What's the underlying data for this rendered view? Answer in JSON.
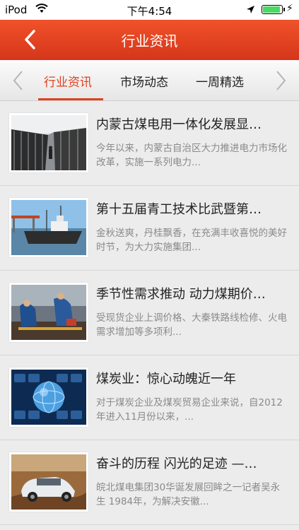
{
  "status_bar": {
    "carrier": "iPod",
    "time": "下午4:54",
    "battery_level": 0.9,
    "wifi_icon": "wifi-icon",
    "location_icon": "location-arrow-icon",
    "charging_icon": "bolt-icon"
  },
  "nav": {
    "title": "行业资讯",
    "back_icon": "chevron-left-icon",
    "color": "#e4431f"
  },
  "tabs": {
    "items": [
      {
        "label": "行业资讯",
        "active": true
      },
      {
        "label": "市场动态",
        "active": false
      },
      {
        "label": "一周精选",
        "active": false
      }
    ],
    "prev_icon": "chevron-left-icon",
    "next_icon": "chevron-right-icon",
    "active_color": "#e0401e"
  },
  "articles": [
    {
      "title": "内蒙古煤电用一体化发展显…",
      "summary": "今年以来，内蒙古自治区大力推进电力市场化改革，实施一系列电力..."
    },
    {
      "title": "第十五届青工技术比武暨第…",
      "summary": "金秋送爽，丹桂飘香，在充满丰收喜悦的美好时节，为大力实施集团..."
    },
    {
      "title": "季节性需求推动 动力煤期价…",
      "summary": "受现货企业上调价格、大秦铁路线检修、火电需求增加等多项利..."
    },
    {
      "title": "煤炭业：惊心动魄近一年",
      "summary": "对于煤炭企业及煤炭贸易企业来说，自2012年进入11月份以来，..."
    },
    {
      "title": "奋斗的历程 闪光的足迹 —…",
      "summary": "皖北煤电集团30华诞发展回眸之一记者吴永生 1984年，为解决安徽..."
    }
  ]
}
